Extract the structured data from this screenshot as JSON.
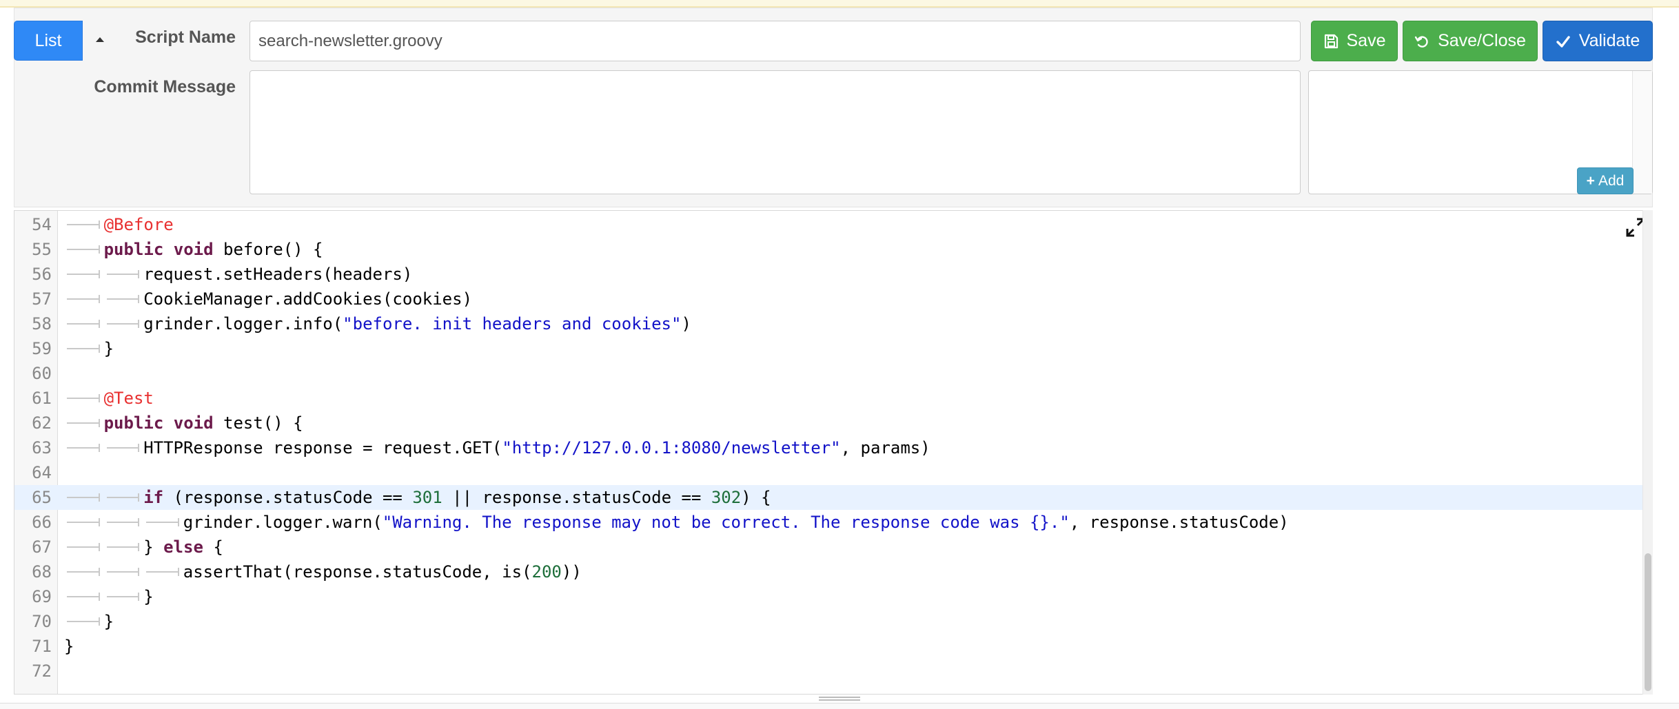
{
  "toolbar": {
    "list_label": "List",
    "script_name_label": "Script Name",
    "script_name_value": "search-newsletter.groovy",
    "commit_message_label": "Commit Message",
    "commit_message_value": "",
    "save_label": "Save",
    "save_close_label": "Save/Close",
    "validate_label": "Validate",
    "add_label": "Add"
  },
  "colors": {
    "list_button": "#2f89f6",
    "save_buttons": "#4cae4c",
    "validate_button": "#2370cc",
    "add_button": "#4aa3c6"
  },
  "editor": {
    "active_line": 65,
    "lines": [
      {
        "n": 54,
        "indent": 1,
        "tokens": [
          {
            "t": "ann",
            "v": "@Before"
          }
        ]
      },
      {
        "n": 55,
        "indent": 1,
        "tokens": [
          {
            "t": "kw",
            "v": "public void"
          },
          {
            "t": "pl",
            "v": " before() {"
          }
        ]
      },
      {
        "n": 56,
        "indent": 2,
        "tokens": [
          {
            "t": "pl",
            "v": "request.setHeaders(headers)"
          }
        ]
      },
      {
        "n": 57,
        "indent": 2,
        "tokens": [
          {
            "t": "pl",
            "v": "CookieManager.addCookies(cookies)"
          }
        ]
      },
      {
        "n": 58,
        "indent": 2,
        "tokens": [
          {
            "t": "pl",
            "v": "grinder.logger.info("
          },
          {
            "t": "str",
            "v": "\"before. init headers and cookies\""
          },
          {
            "t": "pl",
            "v": ")"
          }
        ]
      },
      {
        "n": 59,
        "indent": 1,
        "tokens": [
          {
            "t": "pl",
            "v": "}"
          }
        ]
      },
      {
        "n": 60,
        "indent": 0,
        "tokens": []
      },
      {
        "n": 61,
        "indent": 1,
        "tokens": [
          {
            "t": "ann",
            "v": "@Test"
          }
        ]
      },
      {
        "n": 62,
        "indent": 1,
        "tokens": [
          {
            "t": "kw",
            "v": "public void"
          },
          {
            "t": "pl",
            "v": " test() {"
          }
        ]
      },
      {
        "n": 63,
        "indent": 2,
        "tokens": [
          {
            "t": "pl",
            "v": "HTTPResponse response = request.GET("
          },
          {
            "t": "str",
            "v": "\"http://127.0.0.1:8080/newsletter\""
          },
          {
            "t": "pl",
            "v": ", params)"
          }
        ]
      },
      {
        "n": 64,
        "indent": 0,
        "tokens": []
      },
      {
        "n": 65,
        "indent": 2,
        "tokens": [
          {
            "t": "kw",
            "v": "if"
          },
          {
            "t": "pl",
            "v": " (response.statusCode == "
          },
          {
            "t": "num",
            "v": "301"
          },
          {
            "t": "pl",
            "v": " || response.statusCode == "
          },
          {
            "t": "num",
            "v": "302"
          },
          {
            "t": "pl",
            "v": ") {"
          }
        ]
      },
      {
        "n": 66,
        "indent": 3,
        "tokens": [
          {
            "t": "pl",
            "v": "grinder.logger.warn("
          },
          {
            "t": "str",
            "v": "\"Warning. The response may not be correct. The response code was {}.\""
          },
          {
            "t": "pl",
            "v": ", response.statusCode)"
          }
        ]
      },
      {
        "n": 67,
        "indent": 2,
        "tokens": [
          {
            "t": "pl",
            "v": "} "
          },
          {
            "t": "kw",
            "v": "else"
          },
          {
            "t": "pl",
            "v": " {"
          }
        ]
      },
      {
        "n": 68,
        "indent": 3,
        "tokens": [
          {
            "t": "pl",
            "v": "assertThat(response.statusCode, is("
          },
          {
            "t": "num",
            "v": "200"
          },
          {
            "t": "pl",
            "v": "))"
          }
        ]
      },
      {
        "n": 69,
        "indent": 2,
        "tokens": [
          {
            "t": "pl",
            "v": "}"
          }
        ]
      },
      {
        "n": 70,
        "indent": 1,
        "tokens": [
          {
            "t": "pl",
            "v": "}"
          }
        ]
      },
      {
        "n": 71,
        "indent": 0,
        "tokens": [
          {
            "t": "pl",
            "v": "}"
          }
        ]
      },
      {
        "n": 72,
        "indent": 0,
        "tokens": []
      }
    ]
  }
}
